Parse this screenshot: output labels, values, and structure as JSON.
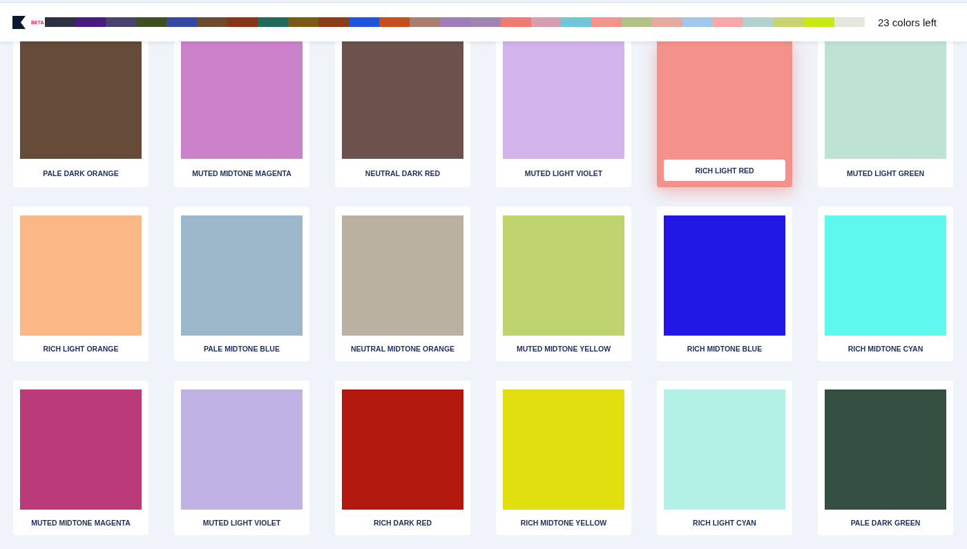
{
  "header": {
    "badge": "BETA",
    "palette": [
      {
        "color": "#2f2f44"
      },
      {
        "color": "#4a1a80"
      },
      {
        "color": "#4a426e"
      },
      {
        "color": "#3e5020"
      },
      {
        "color": "#3549a3"
      },
      {
        "color": "#6e4a2c"
      },
      {
        "color": "#8a3518"
      },
      {
        "color": "#226a5c"
      },
      {
        "color": "#7a5a14"
      },
      {
        "color": "#8e3c18"
      },
      {
        "color": "#1f55dd"
      },
      {
        "color": "#c44e1c"
      },
      {
        "color": "#a87e70"
      },
      {
        "color": "#9f7db8"
      },
      {
        "color": "#9f85b0"
      },
      {
        "color": "#f07a70"
      },
      {
        "color": "#d69eae"
      },
      {
        "color": "#6ec6d8"
      },
      {
        "color": "#f2948a"
      },
      {
        "color": "#b2c286"
      },
      {
        "color": "#e4aaa0"
      },
      {
        "color": "#a0c8ec"
      },
      {
        "color": "#f8a8a8"
      },
      {
        "color": "#b2d2d0"
      },
      {
        "color": "#c8d470"
      },
      {
        "color": "#c8e814"
      },
      {
        "color": "#e6e8dc"
      }
    ],
    "remaining": "23 colors left"
  },
  "swatches": [
    {
      "name": "PALE DARK ORANGE",
      "color": "#664b38",
      "selected": false
    },
    {
      "name": "MUTED MIDTONE MAGENTA",
      "color": "#cb80ca",
      "selected": false
    },
    {
      "name": "NEUTRAL DARK RED",
      "color": "#6c514d",
      "selected": false
    },
    {
      "name": "MUTED LIGHT VIOLET",
      "color": "#d3b4ea",
      "selected": false
    },
    {
      "name": "RICH LIGHT RED",
      "color": "#f2928a",
      "selected": true
    },
    {
      "name": "MUTED LIGHT GREEN",
      "color": "#bce3d3",
      "selected": false
    },
    {
      "name": "RICH LIGHT ORANGE",
      "color": "#fab887",
      "selected": false
    },
    {
      "name": "PALE MIDTONE BLUE",
      "color": "#9bb7c9",
      "selected": false
    },
    {
      "name": "NEUTRAL MIDTONE ORANGE",
      "color": "#bbb1a0",
      "selected": false
    },
    {
      "name": "MUTED MIDTONE YELLOW",
      "color": "#bfd46c",
      "selected": false
    },
    {
      "name": "RICH MIDTONE BLUE",
      "color": "#2118e6",
      "selected": false
    },
    {
      "name": "RICH MIDTONE CYAN",
      "color": "#5ff8ee",
      "selected": false
    },
    {
      "name": "MUTED MIDTONE MAGENTA",
      "color": "#bb3a7a",
      "selected": false
    },
    {
      "name": "MUTED LIGHT VIOLET",
      "color": "#bfb3e3",
      "selected": false
    },
    {
      "name": "RICH DARK RED",
      "color": "#b3180f",
      "selected": false
    },
    {
      "name": "RICH MIDTONE YELLOW",
      "color": "#e1df0f",
      "selected": false
    },
    {
      "name": "RICH LIGHT CYAN",
      "color": "#b3f0e6",
      "selected": false
    },
    {
      "name": "PALE DARK GREEN",
      "color": "#324f40",
      "selected": false
    }
  ]
}
